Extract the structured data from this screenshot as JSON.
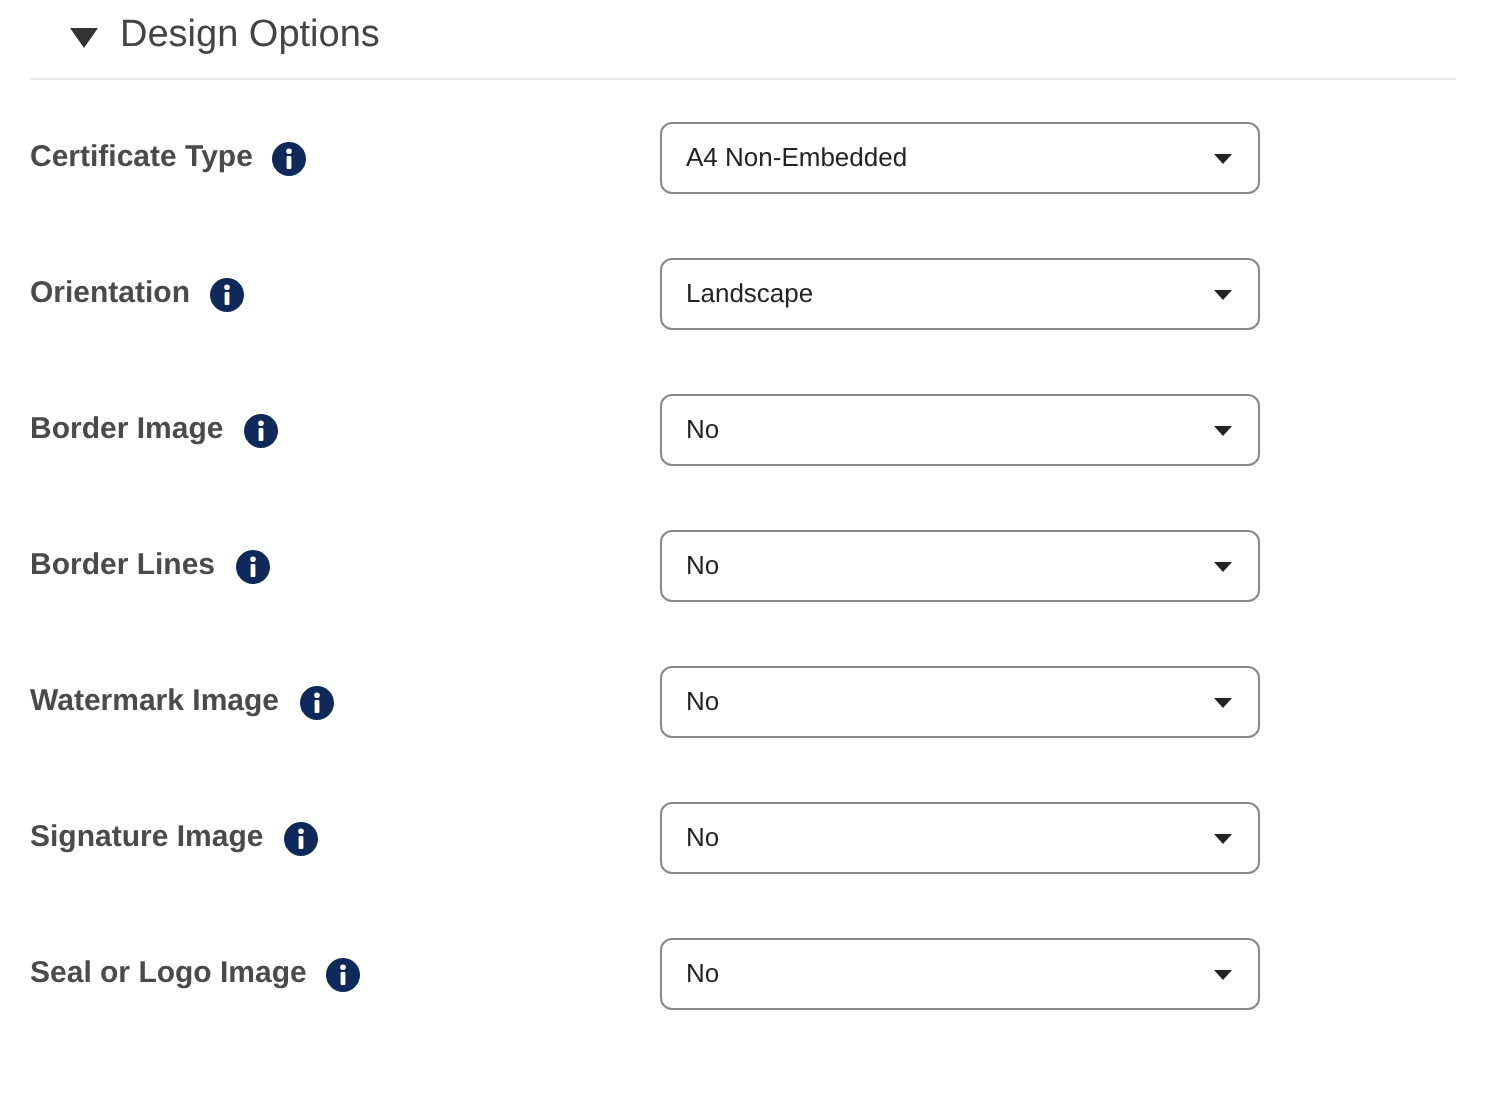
{
  "section": {
    "title": "Design Options",
    "expanded": true
  },
  "fields": [
    {
      "label": "Certificate Type",
      "value": "A4 Non-Embedded"
    },
    {
      "label": "Orientation",
      "value": "Landscape"
    },
    {
      "label": "Border Image",
      "value": "No"
    },
    {
      "label": "Border Lines",
      "value": "No"
    },
    {
      "label": "Watermark Image",
      "value": "No"
    },
    {
      "label": "Signature Image",
      "value": "No"
    },
    {
      "label": "Seal or Logo Image",
      "value": "No"
    }
  ]
}
